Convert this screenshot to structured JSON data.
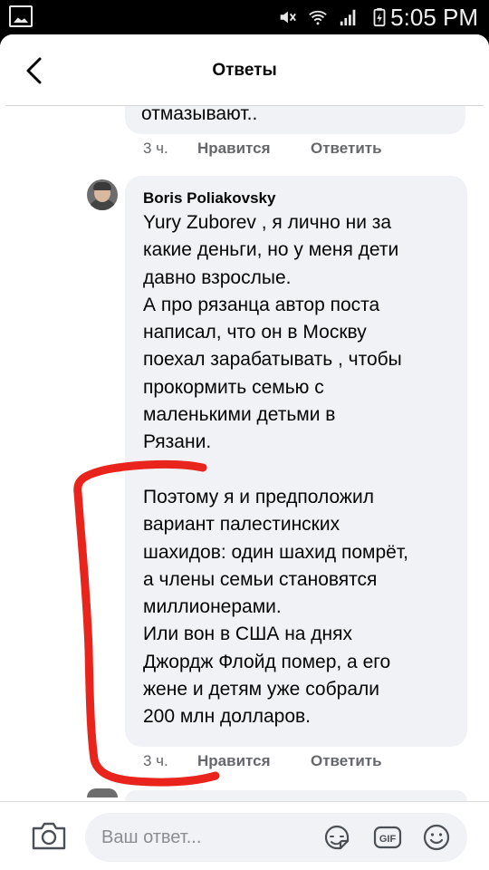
{
  "status_bar": {
    "time": "5:05 PM",
    "icons": [
      "gallery-icon",
      "mute-icon",
      "wifi-icon",
      "signal-icon",
      "battery-icon"
    ]
  },
  "header": {
    "title": "Ответы",
    "back_icon": "chevron-left-icon"
  },
  "previous_comment": {
    "text_tail": "отмазывают..",
    "time": "3 ч.",
    "like_label": "Нравится",
    "reply_label": "Ответить"
  },
  "comment": {
    "author": "Boris Poliakovsky",
    "text": "Yury Zuborev  , я лично ни за\nкакие деньги,  но у меня дети\nдавно взрослые.\nА про рязанца автор поста\nнаписал, что он в Москву\nпоехал зарабатывать , чтобы\nпрокормить семью с\nмаленькими детьми в\nРязани.\n\nПоэтому я и предположил\nвариант палестинских\nшахидов: один шахид помрёт,\nа члены семьи становятся\nмиллионерами.\nИли вон в США на днях\nДжордж Флойд помер, а его\nжене и детям уже собрали\n200 млн долларов.",
    "time": "3 ч.",
    "like_label": "Нравится",
    "reply_label": "Ответить"
  },
  "annotation": {
    "color": "#e8241c",
    "shape": "hand-drawn bracket"
  },
  "composer": {
    "placeholder": "Ваш ответ...",
    "camera_icon": "camera-icon",
    "sticker_icon": "sticker-icon",
    "gif_label": "GIF",
    "emoji_icon": "emoji-icon"
  },
  "colors": {
    "bubble_bg": "#f0f2f5",
    "secondary_text": "#65676b",
    "primary_text": "#050505"
  }
}
